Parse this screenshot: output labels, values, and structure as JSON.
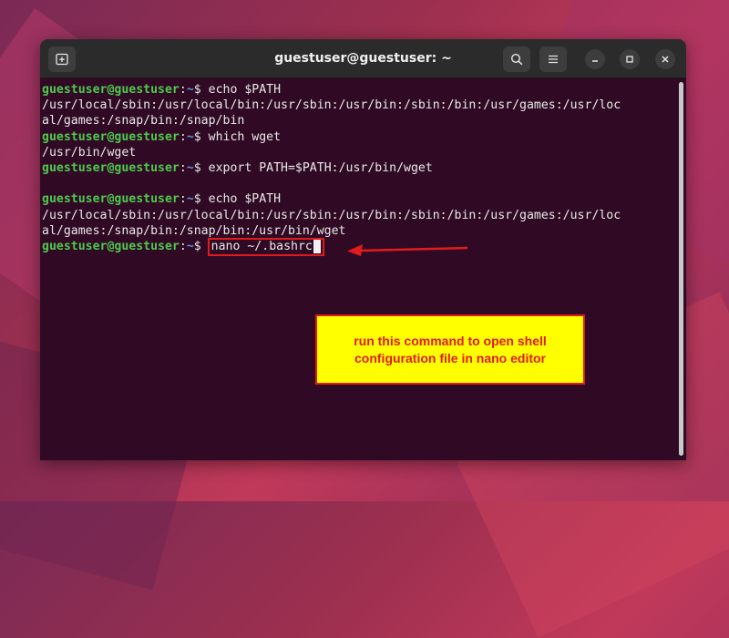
{
  "window": {
    "title": "guestuser@guestuser: ~"
  },
  "icons": {
    "new_tab": "new-tab-icon",
    "search": "search-icon",
    "menu": "hamburger-menu-icon",
    "minimize": "minimize-icon",
    "maximize": "maximize-icon",
    "close": "close-icon"
  },
  "prompt": {
    "user": "guestuser@guestuser",
    "sep": ":",
    "path": "~",
    "symbol": "$"
  },
  "terminal": {
    "cmd1": " echo $PATH",
    "out1a": "/usr/local/sbin:/usr/local/bin:/usr/sbin:/usr/bin:/sbin:/bin:/usr/games:/usr/loc",
    "out1b": "al/games:/snap/bin:/snap/bin",
    "cmd2": " which wget",
    "out2": "/usr/bin/wget",
    "cmd3": " export PATH=$PATH:/usr/bin/wget",
    "cmd4": " echo $PATH",
    "out4a": "/usr/local/sbin:/usr/local/bin:/usr/sbin:/usr/bin:/sbin:/bin:/usr/games:/usr/loc",
    "out4b": "al/games:/snap/bin:/snap/bin:/usr/bin/wget",
    "cmd5": "nano ~/.bashrc"
  },
  "annotation": {
    "line1": "run this command to open shell",
    "line2": "configuration file in nano editor"
  },
  "colors": {
    "terminal_bg": "#300a24",
    "prompt_user": "#4ec94e",
    "prompt_path": "#6a8fd8",
    "highlight_border": "#e01b1b",
    "callout_bg": "#ffff00"
  }
}
